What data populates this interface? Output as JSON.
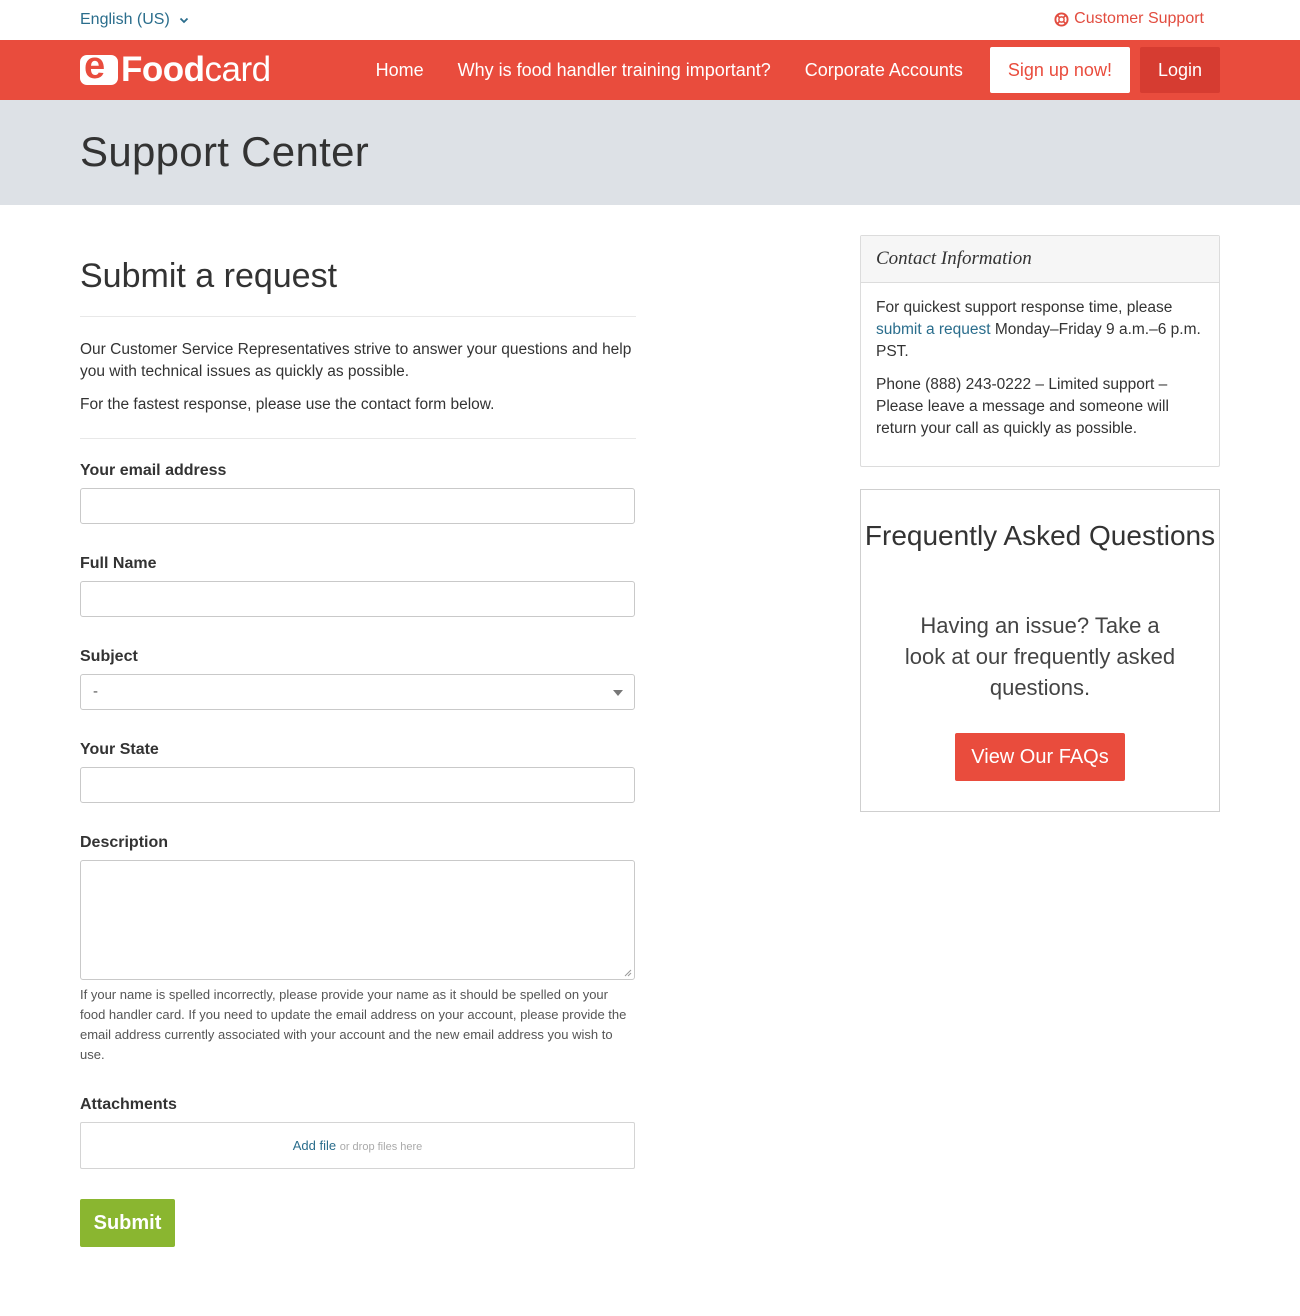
{
  "topbar": {
    "language": "English (US)",
    "customer_support": "Customer Support"
  },
  "header": {
    "logo_food": "Food",
    "logo_card": "card",
    "logo_mark": "e",
    "nav": {
      "home": "Home",
      "why": "Why is food handler training important?",
      "corporate": "Corporate Accounts",
      "signup": "Sign up now!",
      "login": "Login"
    }
  },
  "banner": {
    "title": "Support Center"
  },
  "form": {
    "title": "Submit a request",
    "intro_1": "Our Customer Service Representatives strive to answer your questions and help you with technical issues as quickly as possible.",
    "intro_2": "For the fastest response, please use the contact form below.",
    "email_label": "Your email address",
    "email_value": "",
    "name_label": "Full Name",
    "name_value": "",
    "subject_label": "Subject",
    "subject_value": "-",
    "state_label": "Your State",
    "state_value": "",
    "description_label": "Description",
    "description_value": "",
    "description_hint": "If your name is spelled incorrectly, please provide your name as it should be spelled on your food handler card. If you need to update the email address on your account, please provide the email address currently associated with your account and the new email address you wish to use.",
    "attachments_label": "Attachments",
    "add_file": "Add file",
    "drop_files": "or drop files here",
    "submit": "Submit"
  },
  "contact": {
    "title": "Contact Information",
    "line1_before": "For quickest support response time, please ",
    "line1_link": "submit a request",
    "line1_after": " Monday–Friday 9 a.m.–6 p.m. PST.",
    "line2": "Phone (888) 243-0222 – Limited support – Please leave a message and someone will return your call as quickly as possible."
  },
  "faq": {
    "title": "Frequently Asked Questions",
    "text": "Having an issue? Take a look at our frequently asked questions.",
    "button": "View Our FAQs"
  },
  "colors": {
    "brand_red": "#e94c3d",
    "login_red": "#d63c31",
    "link_blue": "#2a6d8c",
    "submit_green": "#8ab630",
    "banner_gray": "#dde1e6"
  },
  "icons": {
    "language_chevron": "chevron-down-icon",
    "support": "lifebuoy-icon",
    "subject_caret": "caret-down-icon",
    "textarea_resize": "resize-grip-icon"
  }
}
